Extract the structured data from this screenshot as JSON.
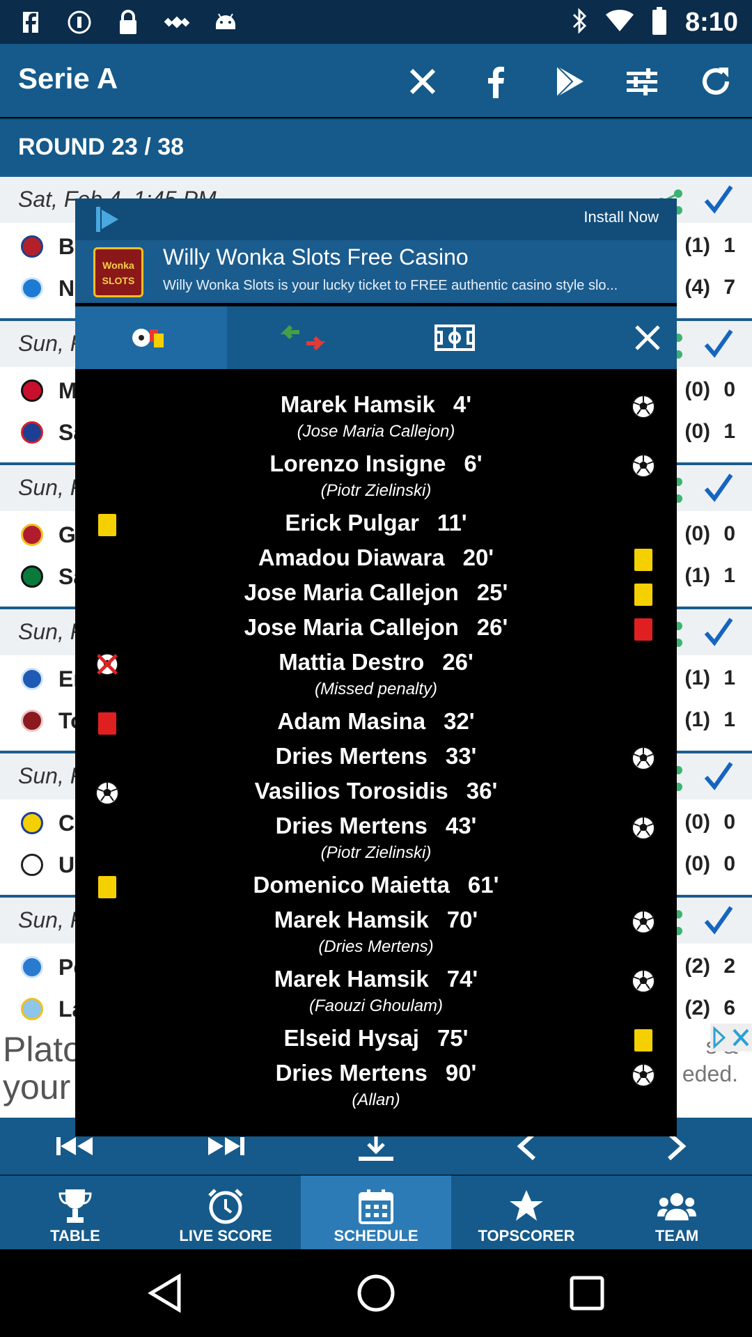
{
  "status_bar": {
    "time": "8:10",
    "left_icons": [
      "facebook-icon",
      "data-saver-icon",
      "lock-icon",
      "fake-gps-icon",
      "android-icon"
    ],
    "right_icons": [
      "bluetooth-icon",
      "wifi-icon",
      "battery-icon"
    ]
  },
  "app_bar": {
    "title": "Serie A",
    "actions": [
      "close-icon",
      "facebook-icon",
      "play-store-icon",
      "filter-icon",
      "refresh-icon"
    ]
  },
  "round": {
    "label": "ROUND 23 / 38"
  },
  "match_list": {
    "dates": [
      "Sat, Feb 4, 1:45 PM",
      "Sun, F",
      "Sun, F",
      "Sun, F",
      "Sun, F",
      "Sun, F"
    ],
    "teams": [
      {
        "name": "Bo",
        "ht": "(1)",
        "ft": "1"
      },
      {
        "name": "Na",
        "ht": "(4)",
        "ft": "7"
      },
      {
        "name": "M",
        "ht": "(0)",
        "ft": "0"
      },
      {
        "name": "Sa",
        "ht": "(0)",
        "ft": "1"
      },
      {
        "name": "Ge",
        "ht": "(0)",
        "ft": "0"
      },
      {
        "name": "Sa",
        "ht": "(1)",
        "ft": "1"
      },
      {
        "name": "Er",
        "ht": "(1)",
        "ft": "1"
      },
      {
        "name": "To",
        "ht": "(1)",
        "ft": "1"
      },
      {
        "name": "Ch",
        "ht": "(0)",
        "ft": "0"
      },
      {
        "name": "Ud",
        "ht": "(0)",
        "ft": "0"
      },
      {
        "name": "Pe",
        "ht": "(2)",
        "ft": "2"
      },
      {
        "name": "La",
        "ht": "(2)",
        "ft": "6"
      }
    ]
  },
  "bottom_ad": {
    "left_line1": "Plato",
    "left_line2": "your",
    "right_line1": "s &",
    "right_line2": "eded."
  },
  "ad_banner": {
    "install": "Install Now",
    "app_name": "Willy Wonka Slots Free Casino",
    "app_desc": "Willy Wonka Slots is your lucky ticket to FREE authentic casino style slo...",
    "thumb_text": "Wonka SLOTS"
  },
  "dialog_tabs": [
    "events-tab",
    "substitutions-tab",
    "lineup-tab",
    "close-icon"
  ],
  "events": [
    {
      "player": "Marek Hamsik",
      "minute": "4'",
      "note": "(Jose Maria Callejon)",
      "side": "right",
      "icon": "goal"
    },
    {
      "player": "Lorenzo Insigne",
      "minute": "6'",
      "note": "(Piotr Zielinski)",
      "side": "right",
      "icon": "goal"
    },
    {
      "player": "Erick Pulgar",
      "minute": "11'",
      "note": "",
      "side": "left",
      "icon": "yellow"
    },
    {
      "player": "Amadou Diawara",
      "minute": "20'",
      "note": "",
      "side": "right",
      "icon": "yellow"
    },
    {
      "player": "Jose Maria Callejon",
      "minute": "25'",
      "note": "",
      "side": "right",
      "icon": "yellow"
    },
    {
      "player": "Jose Maria Callejon",
      "minute": "26'",
      "note": "",
      "side": "right",
      "icon": "red"
    },
    {
      "player": "Mattia Destro",
      "minute": "26'",
      "note": "(Missed penalty)",
      "side": "left",
      "icon": "missed"
    },
    {
      "player": "Adam Masina",
      "minute": "32'",
      "note": "",
      "side": "left",
      "icon": "red"
    },
    {
      "player": "Dries Mertens",
      "minute": "33'",
      "note": "",
      "side": "right",
      "icon": "goal"
    },
    {
      "player": "Vasilios Torosidis",
      "minute": "36'",
      "note": "",
      "side": "left",
      "icon": "goal"
    },
    {
      "player": "Dries Mertens",
      "minute": "43'",
      "note": "(Piotr Zielinski)",
      "side": "right",
      "icon": "goal"
    },
    {
      "player": "Domenico Maietta",
      "minute": "61'",
      "note": "",
      "side": "left",
      "icon": "yellow"
    },
    {
      "player": "Marek Hamsik",
      "minute": "70'",
      "note": "(Dries Mertens)",
      "side": "right",
      "icon": "goal"
    },
    {
      "player": "Marek Hamsik",
      "minute": "74'",
      "note": "(Faouzi Ghoulam)",
      "side": "right",
      "icon": "goal"
    },
    {
      "player": "Elseid Hysaj",
      "minute": "75'",
      "note": "",
      "side": "right",
      "icon": "yellow"
    },
    {
      "player": "Dries Mertens",
      "minute": "90'",
      "note": "(Allan)",
      "side": "right",
      "icon": "goal"
    }
  ],
  "nav_controls": [
    "skip-first-icon",
    "skip-last-icon",
    "download-icon",
    "prev-icon",
    "next-icon"
  ],
  "tabs": [
    {
      "label": "TABLE",
      "icon": "trophy-icon"
    },
    {
      "label": "LIVE SCORE",
      "icon": "clock-icon"
    },
    {
      "label": "SCHEDULE",
      "icon": "calendar-icon",
      "active": true
    },
    {
      "label": "TOPSCORER",
      "icon": "star-icon"
    },
    {
      "label": "TEAM",
      "icon": "team-icon"
    }
  ],
  "colors": {
    "primary": "#155a8a",
    "active_tab": "#2c7bb6",
    "check": "#1565c0",
    "share": "#3cb371",
    "yellow_card": "#f5d000",
    "red_card": "#e02020"
  }
}
